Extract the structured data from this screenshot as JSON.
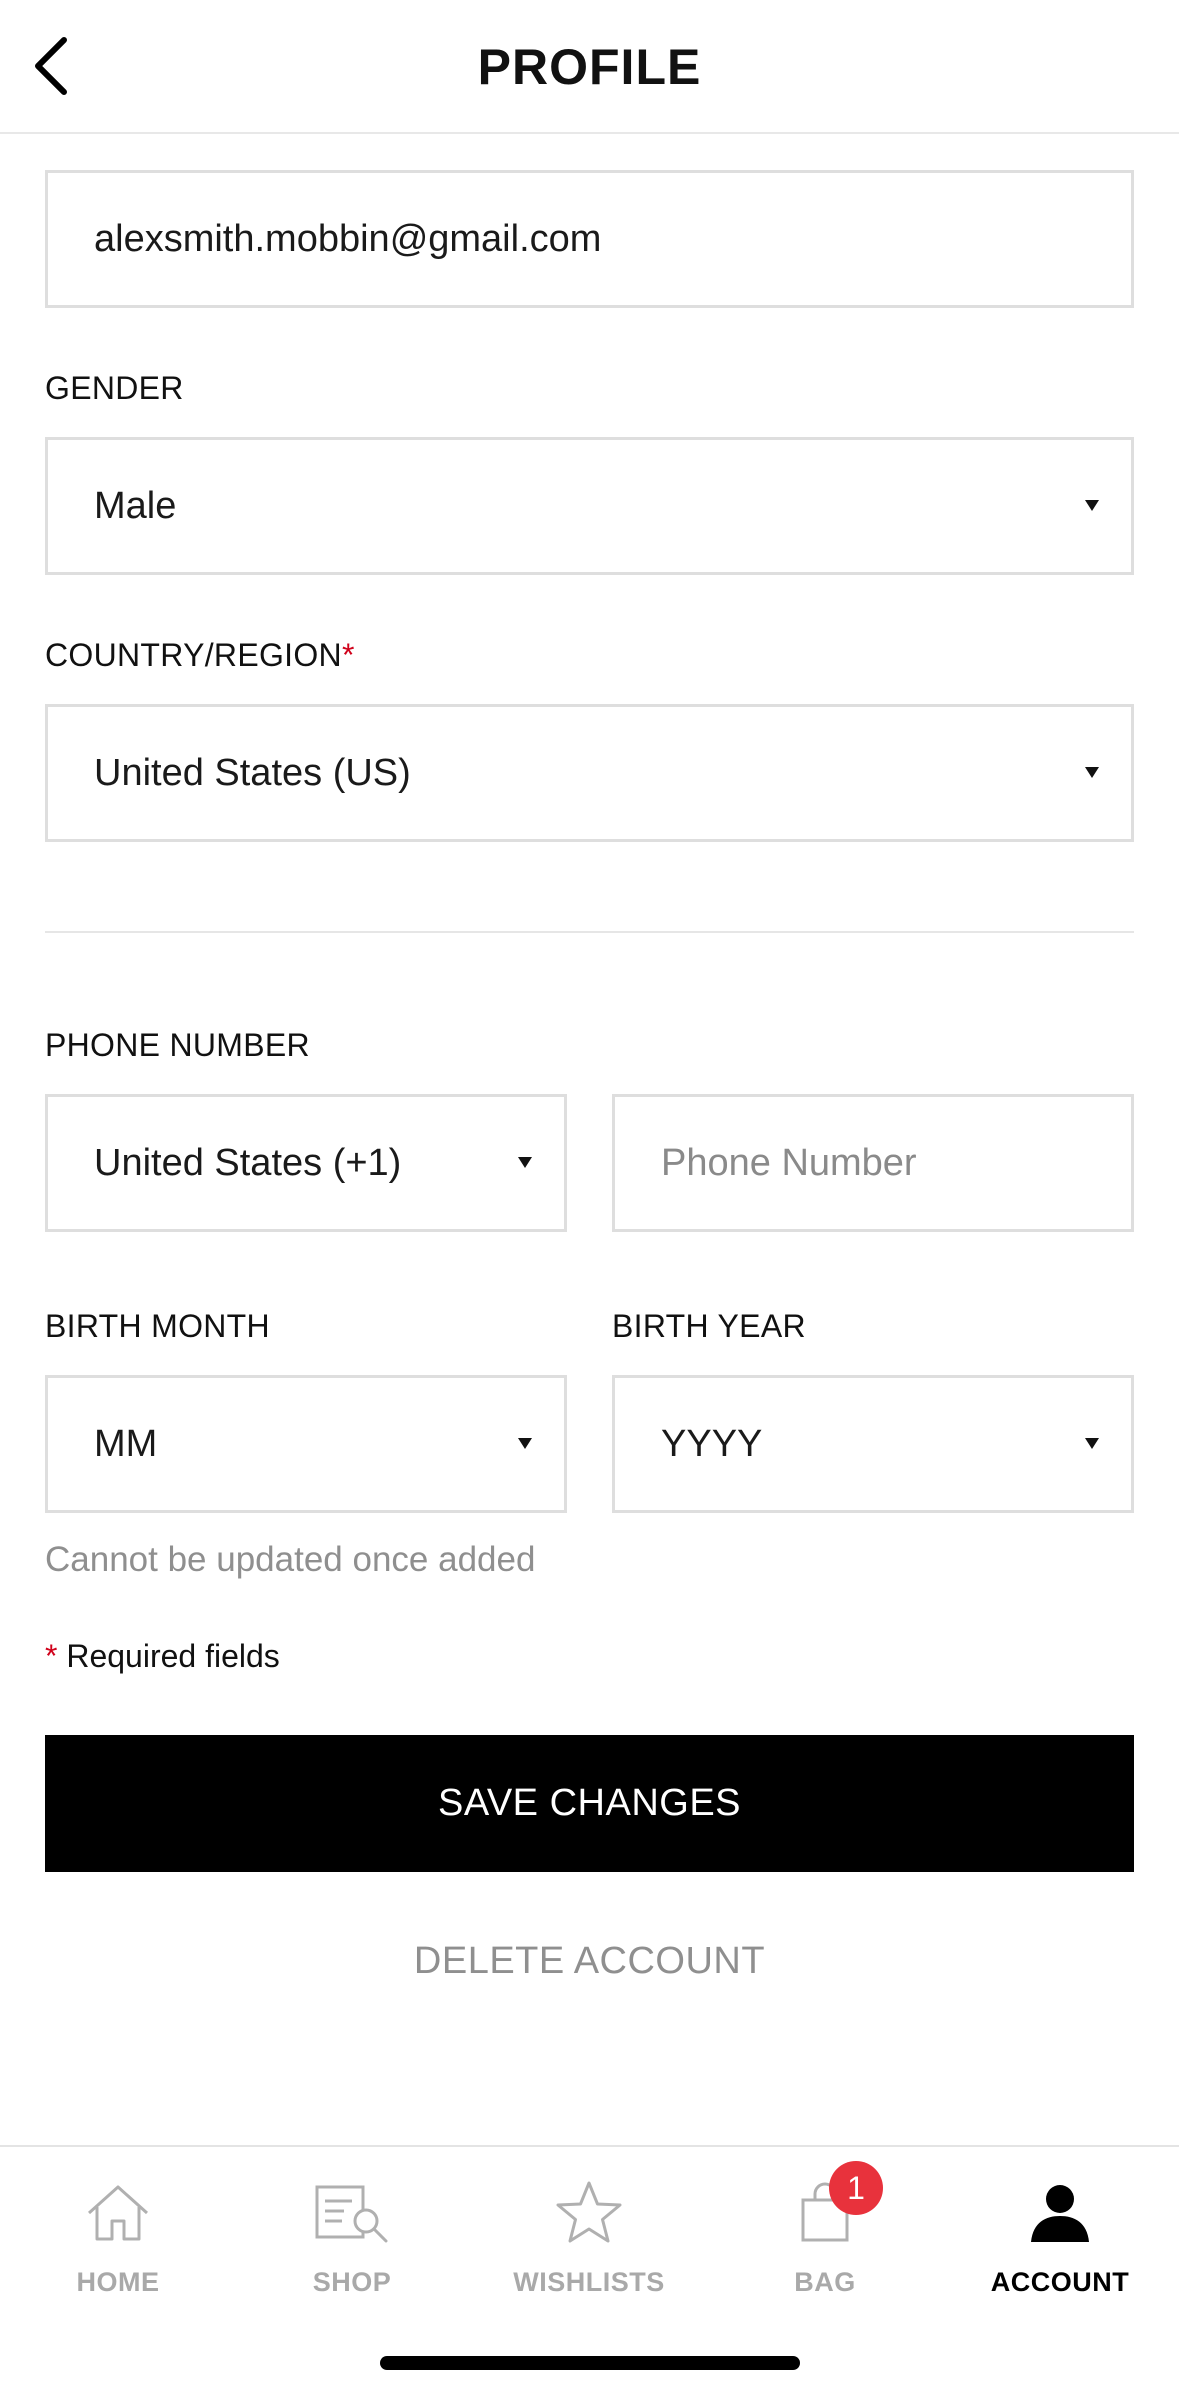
{
  "header": {
    "title": "PROFILE"
  },
  "form": {
    "email_value": "alexsmith.mobbin@gmail.com",
    "gender_label": "GENDER",
    "gender_value": "Male",
    "country_label": "COUNTRY/REGION",
    "country_required": "*",
    "country_value": "United States (US)",
    "phone_label": "PHONE NUMBER",
    "phone_country_value": "United States (+1)",
    "phone_placeholder": "Phone Number",
    "birth_month_label": "BIRTH MONTH",
    "birth_month_value": "MM",
    "birth_year_label": "BIRTH YEAR",
    "birth_year_value": "YYYY",
    "birth_hint": "Cannot be updated once added",
    "required_star": "*",
    "required_note": " Required fields",
    "save_label": "SAVE CHANGES",
    "delete_label": "DELETE ACCOUNT"
  },
  "tabbar": {
    "items": [
      {
        "label": "HOME",
        "icon": "home-icon"
      },
      {
        "label": "SHOP",
        "icon": "shop-search-icon"
      },
      {
        "label": "WISHLISTS",
        "icon": "star-icon"
      },
      {
        "label": "BAG",
        "icon": "bag-icon",
        "badge": "1"
      },
      {
        "label": "ACCOUNT",
        "icon": "account-icon",
        "active": true
      }
    ]
  },
  "colors": {
    "accent": "#000000",
    "required": "#d0021b",
    "badge": "#e8323c",
    "muted": "#8f8f8f"
  }
}
